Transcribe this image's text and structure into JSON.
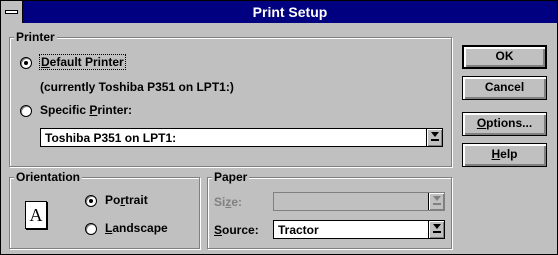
{
  "window": {
    "title": "Print Setup"
  },
  "printer": {
    "group_label": "Printer",
    "default_label": "Default Printer",
    "default_current": "(currently Toshiba P351 on LPT1:)",
    "specific_label": "Specific Printer:",
    "specific_value": "Toshiba P351 on LPT1:",
    "selected": "default"
  },
  "orientation": {
    "group_label": "Orientation",
    "portrait_label": "Portrait",
    "landscape_label": "Landscape",
    "icon_letter": "A",
    "selected": "portrait"
  },
  "paper": {
    "group_label": "Paper",
    "size_label": "Size:",
    "size_value": "",
    "source_label": "Source:",
    "source_value": "Tractor"
  },
  "buttons": {
    "ok": "OK",
    "cancel": "Cancel",
    "options": "Options...",
    "help": "Help"
  },
  "colors": {
    "titlebar": "#000080",
    "face": "#c0c0c0",
    "shadow": "#808080"
  },
  "icons": [
    "system-menu-icon",
    "dropdown-arrow-icon",
    "portrait-page-icon"
  ]
}
